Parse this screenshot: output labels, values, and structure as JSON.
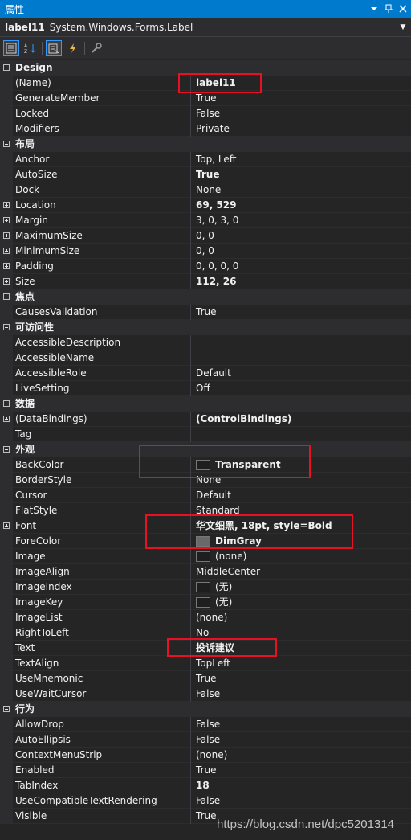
{
  "window": {
    "title": "属性"
  },
  "object_selector": {
    "name": "label11",
    "type": "System.Windows.Forms.Label"
  },
  "toolbar": {
    "buttons": [
      "categorized-icon",
      "alphabetical-icon",
      "properties-icon",
      "events-icon",
      "property-pages-icon"
    ]
  },
  "colors": {
    "transparent_swatch": "#1e1e1e",
    "dimgray_swatch": "#696969",
    "black_swatch": "#1e1e1e",
    "highlight": "#e81123",
    "title_bar": "#007acc"
  },
  "categories": [
    {
      "name": "Design",
      "rows": [
        {
          "name": "(Name)",
          "value": "label11",
          "bold": true
        },
        {
          "name": "GenerateMember",
          "value": "True"
        },
        {
          "name": "Locked",
          "value": "False"
        },
        {
          "name": "Modifiers",
          "value": "Private"
        }
      ]
    },
    {
      "name": "布局",
      "rows": [
        {
          "name": "Anchor",
          "value": "Top, Left"
        },
        {
          "name": "AutoSize",
          "value": "True",
          "bold": true
        },
        {
          "name": "Dock",
          "value": "None"
        },
        {
          "name": "Location",
          "value": "69, 529",
          "bold": true,
          "expand": true
        },
        {
          "name": "Margin",
          "value": "3, 0, 3, 0",
          "expand": true
        },
        {
          "name": "MaximumSize",
          "value": "0, 0",
          "expand": true
        },
        {
          "name": "MinimumSize",
          "value": "0, 0",
          "expand": true
        },
        {
          "name": "Padding",
          "value": "0, 0, 0, 0",
          "expand": true
        },
        {
          "name": "Size",
          "value": "112, 26",
          "bold": true,
          "expand": true
        }
      ]
    },
    {
      "name": "焦点",
      "rows": [
        {
          "name": "CausesValidation",
          "value": "True"
        }
      ]
    },
    {
      "name": "可访问性",
      "rows": [
        {
          "name": "AccessibleDescription",
          "value": ""
        },
        {
          "name": "AccessibleName",
          "value": ""
        },
        {
          "name": "AccessibleRole",
          "value": "Default"
        },
        {
          "name": "LiveSetting",
          "value": "Off"
        }
      ]
    },
    {
      "name": "数据",
      "rows": [
        {
          "name": "(DataBindings)",
          "value": "(ControlBindings)",
          "bold": true,
          "expand": true
        },
        {
          "name": "Tag",
          "value": ""
        }
      ]
    },
    {
      "name": "外观",
      "rows": [
        {
          "name": "BackColor",
          "value": "Transparent",
          "bold": true,
          "swatch": "transparent_swatch"
        },
        {
          "name": "BorderStyle",
          "value": "None"
        },
        {
          "name": "Cursor",
          "value": "Default"
        },
        {
          "name": "FlatStyle",
          "value": "Standard"
        },
        {
          "name": "Font",
          "value": "华文细黑, 18pt, style=Bold",
          "bold": true,
          "expand": true
        },
        {
          "name": "ForeColor",
          "value": "DimGray",
          "bold": true,
          "swatch": "dimgray_swatch"
        },
        {
          "name": "Image",
          "value": "(none)",
          "swatch": "black_swatch"
        },
        {
          "name": "ImageAlign",
          "value": "MiddleCenter"
        },
        {
          "name": "ImageIndex",
          "value": "(无)",
          "swatch": "black_swatch"
        },
        {
          "name": "ImageKey",
          "value": "(无)",
          "swatch": "black_swatch"
        },
        {
          "name": "ImageList",
          "value": "(none)"
        },
        {
          "name": "RightToLeft",
          "value": "No"
        },
        {
          "name": "Text",
          "value": "投诉建议",
          "bold": true
        },
        {
          "name": "TextAlign",
          "value": "TopLeft"
        },
        {
          "name": "UseMnemonic",
          "value": "True"
        },
        {
          "name": "UseWaitCursor",
          "value": "False"
        }
      ]
    },
    {
      "name": "行为",
      "rows": [
        {
          "name": "AllowDrop",
          "value": "False"
        },
        {
          "name": "AutoEllipsis",
          "value": "False"
        },
        {
          "name": "ContextMenuStrip",
          "value": "(none)"
        },
        {
          "name": "Enabled",
          "value": "True"
        },
        {
          "name": "TabIndex",
          "value": "18",
          "bold": true
        },
        {
          "name": "UseCompatibleTextRendering",
          "value": "False"
        },
        {
          "name": "Visible",
          "value": "True"
        }
      ]
    }
  ],
  "watermark": "https://blog.csdn.net/dpc5201314"
}
